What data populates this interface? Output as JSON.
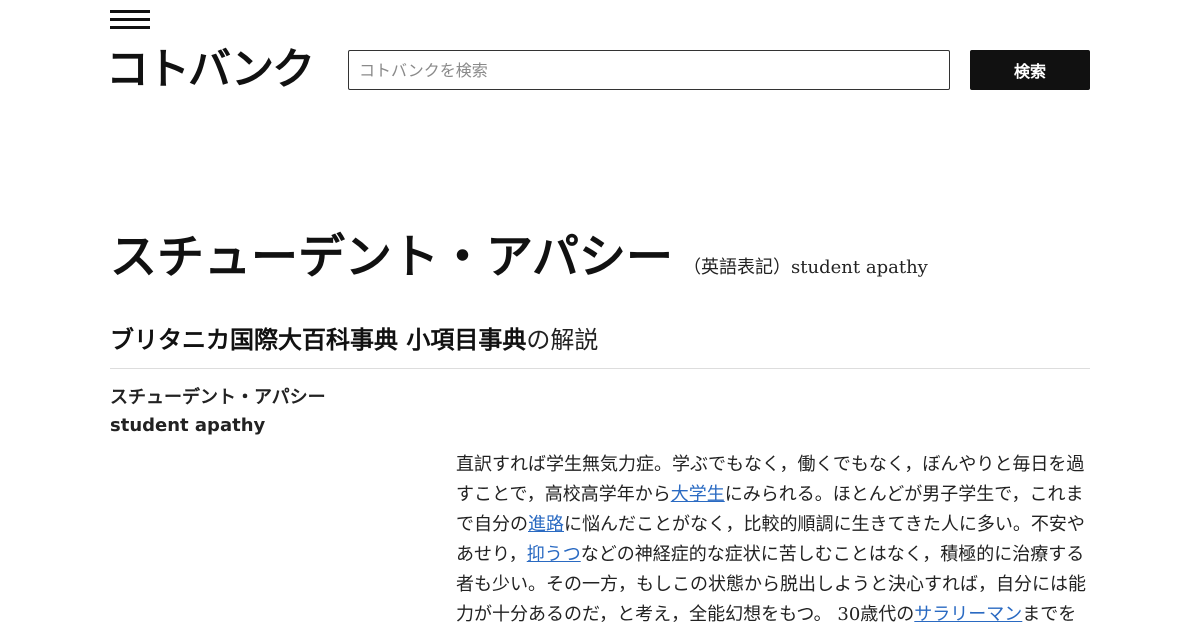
{
  "header": {
    "logo": "コトバンク",
    "search_placeholder": "コトバンクを検索",
    "search_button": "検索"
  },
  "entry": {
    "title": "スチューデント・アパシー",
    "english_note": "（英語表記）student apathy",
    "dictionary_name": "ブリタニカ国際大百科事典 小項目事典",
    "dictionary_suffix": "の解説",
    "headword_ja": "スチューデント・アパシー",
    "headword_en": "student apathy",
    "body": [
      {
        "type": "text",
        "text": "直訳すれば学生無気力症。学ぶでもなく，働くでもなく，ぼんやりと毎日を過すことで，高校高学年から"
      },
      {
        "type": "link",
        "text": "大学生"
      },
      {
        "type": "text",
        "text": "にみられる。ほとんどが男子学生で，これまで自分の"
      },
      {
        "type": "link",
        "text": "進路"
      },
      {
        "type": "text",
        "text": "に悩んだことがなく，比較的順調に生きてきた人に多い。不安やあせり，"
      },
      {
        "type": "link",
        "text": "抑うつ"
      },
      {
        "type": "text",
        "text": "などの神経症的な症状に苦しむことはなく，積極的に治療する者も少い。その一方，もしこの状態から脱出しようと決心すれば，自分には能力が十分あるのだ，と考え，全能幻想をもつ。 30歳代の"
      },
      {
        "type": "link",
        "text": "サラリーマン"
      },
      {
        "type": "text",
        "text": "までを"
      }
    ]
  },
  "colors": {
    "link": "#2a6ac2",
    "button_bg": "#111111",
    "divider": "#dddddd"
  }
}
